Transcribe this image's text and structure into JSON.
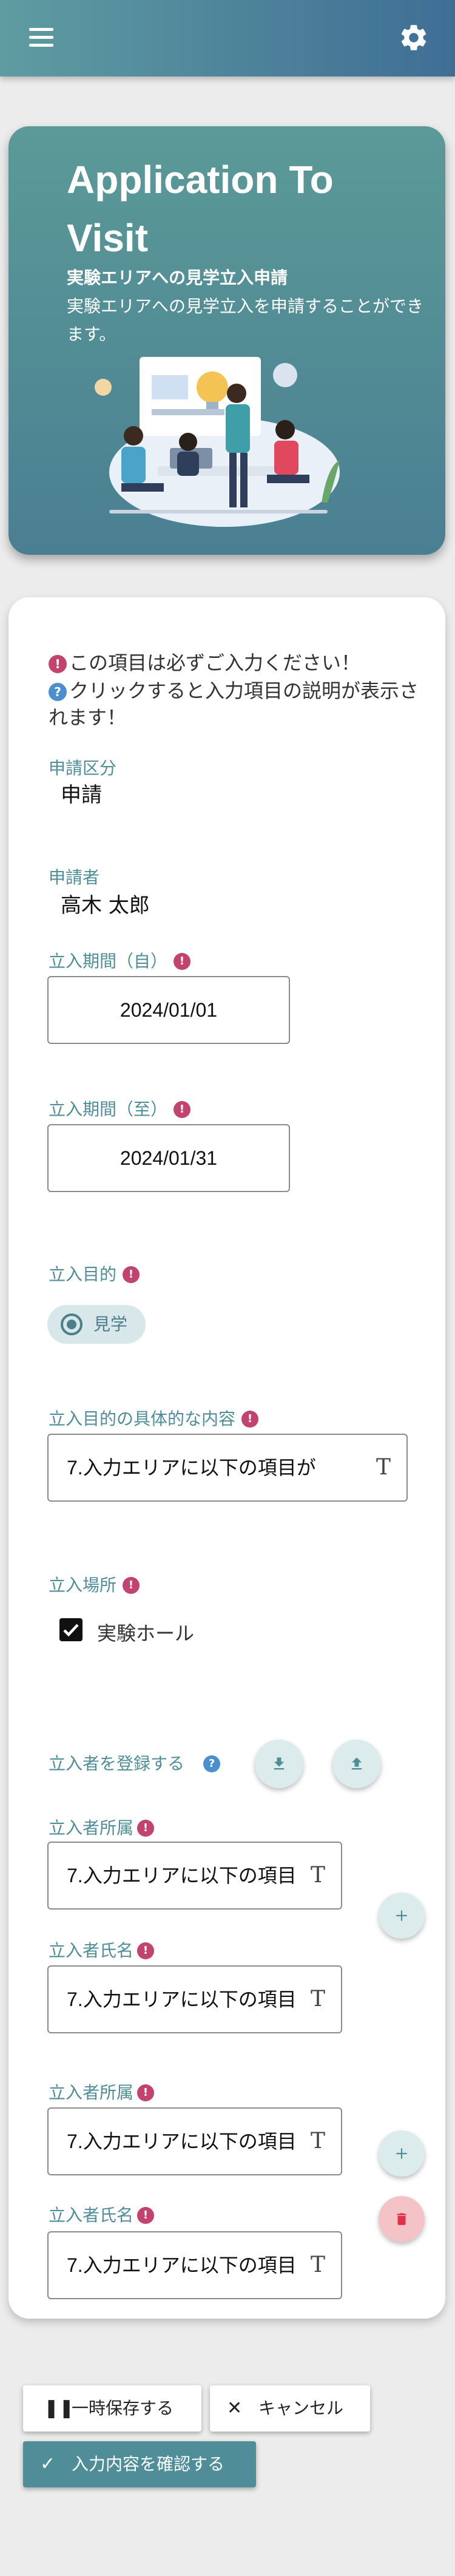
{
  "header": {
    "menu_icon": "hamburger-menu-icon",
    "settings_icon": "gear-icon"
  },
  "hero": {
    "title": "Application To Visit",
    "subtitle": "実験エリアへの見学立入申請",
    "description": "実験エリアへの見学立入を申請することができます。"
  },
  "notices": {
    "required": "この項目は必ずご入力ください！",
    "help": "クリックすると入力項目の説明が表示されます！"
  },
  "form": {
    "application_type": {
      "label": "申請区分",
      "value": "申請"
    },
    "applicant": {
      "label": "申請者",
      "value": "高木 太郎"
    },
    "period_from": {
      "label": "立入期間（自）",
      "value": "2024/01/01"
    },
    "period_to": {
      "label": "立入期間（至）",
      "value": "2024/01/31"
    },
    "purpose": {
      "label": "立入目的",
      "option": "見学"
    },
    "purpose_detail": {
      "label": "立入目的の具体的な内容",
      "value": "7.入力エリアに以下の項目が"
    },
    "location": {
      "label": "立入場所",
      "option": "実験ホール",
      "checked": true
    },
    "register": {
      "label": "立入者を登録する"
    },
    "visitors": [
      {
        "affiliation_label": "立入者所属",
        "affiliation_value": "7.入力エリアに以下の項目",
        "name_label": "立入者氏名",
        "name_value": "7.入力エリアに以下の項目"
      },
      {
        "affiliation_label": "立入者所属",
        "affiliation_value": "7.入力エリアに以下の項目",
        "name_label": "立入者氏名",
        "name_value": "7.入力エリアに以下の項目"
      }
    ]
  },
  "actions": {
    "save": "一時保存する",
    "cancel": "キャンセル",
    "confirm": "入力内容を確認する"
  },
  "colors": {
    "accent": "#4f8e98",
    "required_dot": "#c2446e",
    "help_dot": "#4c8fd0",
    "delete_button": "#f3c3c8"
  }
}
